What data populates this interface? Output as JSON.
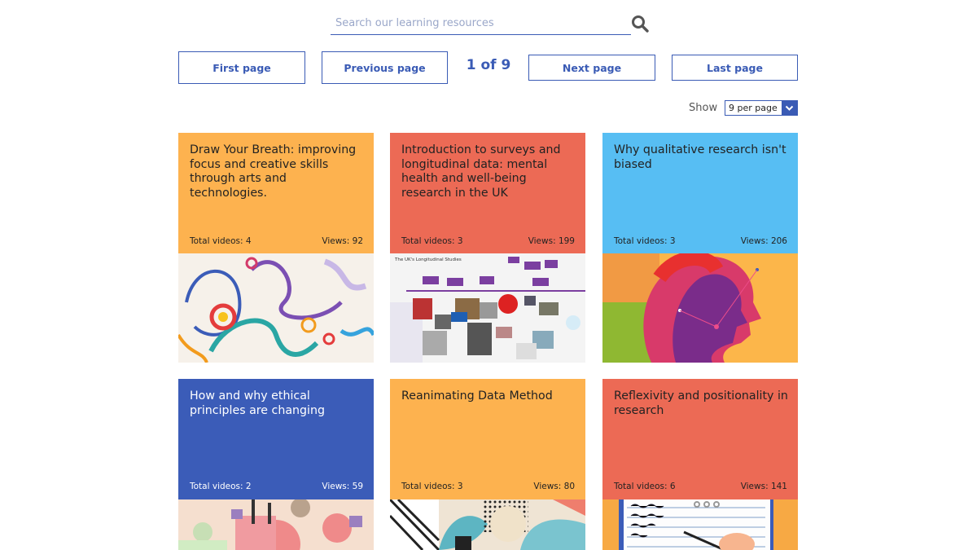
{
  "search": {
    "placeholder": "Search our learning resources",
    "value": ""
  },
  "pagination": {
    "first_label": "First page",
    "previous_label": "Previous page",
    "count": "1 of 9",
    "next_label": "Next page",
    "last_label": "Last page"
  },
  "show": {
    "label": "Show",
    "selected": "9 per page"
  },
  "cards": [
    {
      "title": "Draw Your Breath: improving focus and creative skills through arts and technologies.",
      "videos": "Total videos: 4",
      "views": "Views: 92",
      "color": "#fdb24f"
    },
    {
      "title": "Introduction to surveys and longitudinal data: mental health and well-being research in the UK",
      "videos": "Total videos: 3",
      "views": "Views: 199",
      "color": "#ec6a55",
      "thumb_text": "The UK's Longitudinal Studies"
    },
    {
      "title": "Why qualitative research isn't biased",
      "videos": "Total videos: 3",
      "views": "Views: 206",
      "color": "#57bef3"
    },
    {
      "title": "How and why ethical principles are changing",
      "videos": "Total videos: 2",
      "views": "Views: 59",
      "color": "#3b5cb8"
    },
    {
      "title": "Reanimating Data Method",
      "videos": "Total videos: 3",
      "views": "Views: 80",
      "color": "#fdb24f"
    },
    {
      "title": "Reflexivity and positionality in research",
      "videos": "Total videos: 6",
      "views": "Views: 141",
      "color": "#ec6a55"
    }
  ],
  "icons": {
    "search": "search-icon",
    "dropdown": "chevron-down-icon"
  },
  "colors": {
    "accent": "#3a5bb5"
  }
}
